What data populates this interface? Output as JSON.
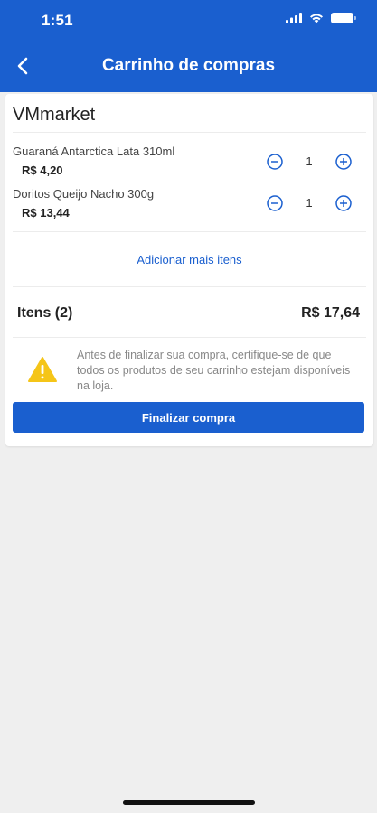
{
  "status_bar": {
    "time": "1:51"
  },
  "header": {
    "title": "Carrinho de compras"
  },
  "store": {
    "name": "VMmarket"
  },
  "items": [
    {
      "name": "Guaraná Antarctica Lata 310ml",
      "price": "R$ 4,20",
      "quantity": "1"
    },
    {
      "name": "Doritos Queijo Nacho 300g",
      "price": "R$ 13,44",
      "quantity": "1"
    }
  ],
  "add_more_label": "Adicionar mais itens",
  "summary": {
    "items_label": "Itens (2)",
    "total": "R$ 17,64"
  },
  "warning": {
    "text": "Antes de finalizar sua compra, certifique-se de que todos os produtos de seu carrinho estejam disponíveis na loja."
  },
  "finish_button_label": "Finalizar compra",
  "colors": {
    "primary": "#1a5fcf",
    "warning": "#f5c518"
  }
}
